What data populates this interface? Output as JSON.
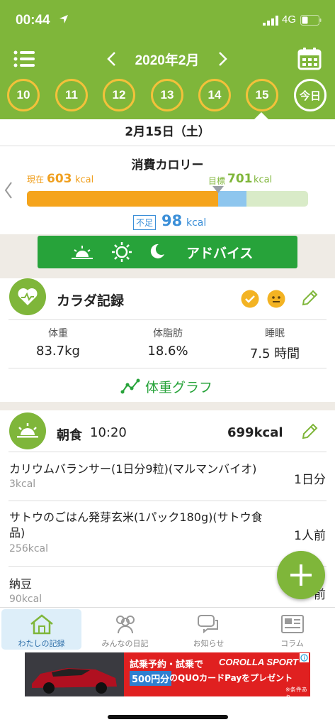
{
  "status_bar": {
    "time": "00:44",
    "network": "4G"
  },
  "header": {
    "month": "2020年2月",
    "days": [
      "10",
      "11",
      "12",
      "13",
      "14",
      "15"
    ],
    "today_label": "今日",
    "colors": {
      "background": "#7fb63a",
      "day_ring": "#f3c13a"
    }
  },
  "date_bar": {
    "label": "2月15日（土）"
  },
  "calories": {
    "title": "消費カロリー",
    "current_label": "現在",
    "current_value": "603",
    "current_unit": "kcal",
    "goal_label": "目標",
    "goal_value": "701",
    "goal_unit": "kcal",
    "deficit_label": "不足",
    "deficit_value": "98",
    "deficit_unit": "kcal",
    "current_fraction": 0.68,
    "goal_fraction": 0.78,
    "colors": {
      "current": "#f5a41c",
      "goal": "#8ec6ee",
      "deficit": "#3b8fd8"
    }
  },
  "advice": {
    "label": "アドバイス",
    "icons": [
      "sunrise-icon",
      "sun-icon",
      "moon-icon"
    ]
  },
  "body_record": {
    "title": "カラダ記録",
    "stats": [
      {
        "label": "体重",
        "value": "83.7kg"
      },
      {
        "label": "体脂肪",
        "value": "18.6%"
      },
      {
        "label": "睡眠",
        "value": "7.5 時間"
      }
    ],
    "graph_link": "体重グラフ"
  },
  "breakfast": {
    "title": "朝食",
    "time": "10:20",
    "total": "699kcal",
    "items": [
      {
        "name": "カリウムバランサー(1日分9粒)(マルマンバイオ)",
        "kcal": "3kcal",
        "qty": "1日分"
      },
      {
        "name": "サトウのごはん発芽玄米(1パック180g)(サトウ食品)",
        "kcal": "256kcal",
        "qty": "1人前"
      },
      {
        "name": "納豆",
        "kcal": "90kcal",
        "qty": "前"
      }
    ]
  },
  "tabs": [
    {
      "label": "わたしの記録",
      "icon": "home-icon",
      "active": true
    },
    {
      "label": "みんなの日記",
      "icon": "people-icon",
      "active": false
    },
    {
      "label": "お知らせ",
      "icon": "chat-icon",
      "active": false
    },
    {
      "label": "コラム",
      "icon": "newspaper-icon",
      "active": false
    }
  ],
  "ad": {
    "line1": "試乗予約・試乗で",
    "brand": "COROLLA SPORT",
    "price": "500円分",
    "line2": "のQUOカードPayをプレゼント",
    "note": "※条件あり"
  }
}
